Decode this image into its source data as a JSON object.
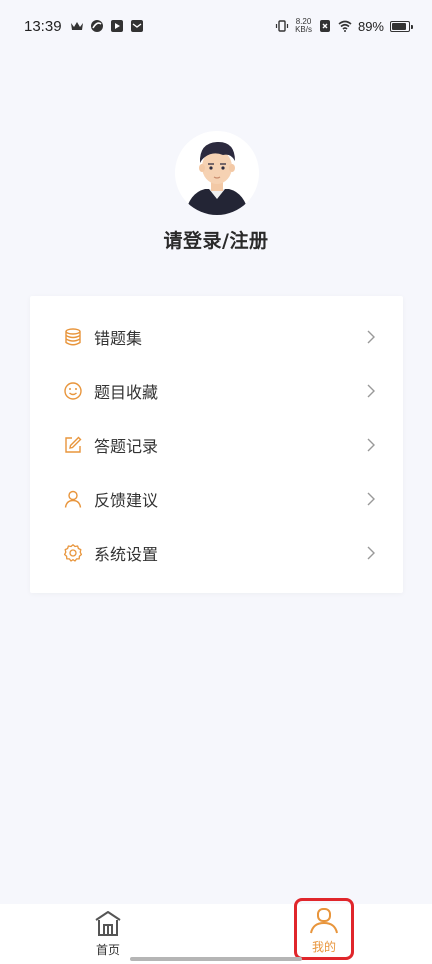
{
  "status_bar": {
    "time": "13:39",
    "net_speed_value": "8.20",
    "net_speed_unit": "KB/s",
    "battery_percent": "89%",
    "battery_level": 0.89
  },
  "profile": {
    "login_label": "请登录/注册"
  },
  "menu": {
    "items": [
      {
        "label": "错题集",
        "icon": "database-icon"
      },
      {
        "label": "题目收藏",
        "icon": "smile-icon"
      },
      {
        "label": "答题记录",
        "icon": "edit-icon"
      },
      {
        "label": "反馈建议",
        "icon": "user-icon"
      },
      {
        "label": "系统设置",
        "icon": "gear-icon"
      }
    ]
  },
  "bottom_nav": {
    "home_label": "首页",
    "mine_label": "我的"
  },
  "colors": {
    "accent": "#e8953c",
    "highlight_border": "#e0262b",
    "background": "#f6f7fc"
  }
}
